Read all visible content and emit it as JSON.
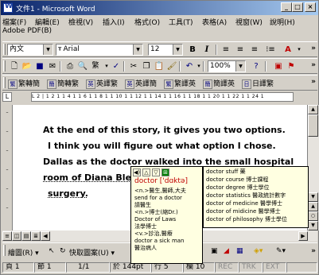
{
  "window": {
    "title": "文件1 - Microsoft Word"
  },
  "menu": [
    "檔案(F)",
    "編輯(E)",
    "檢視(V)",
    "插入(I)",
    "格式(O)",
    "工具(T)",
    "表格(A)",
    "視窗(W)",
    "說明(H)",
    "Adobe PDF(B)"
  ],
  "format_toolbar": {
    "style": "內文",
    "font": "Arial",
    "size": "12",
    "bold": "B",
    "italic": "I"
  },
  "standard_toolbar": {
    "zoom": "100%"
  },
  "convert_toolbar": [
    {
      "icon": "繁",
      "label": "繁轉簡"
    },
    {
      "icon": "簡",
      "label": "簡轉繁"
    },
    {
      "icon": "英",
      "label": "英譯繁"
    },
    {
      "icon": "英",
      "label": "英譯簡"
    },
    {
      "icon": "繁",
      "label": "繁譯英"
    },
    {
      "icon": "簡",
      "label": "簡譯英"
    },
    {
      "icon": "日",
      "label": "日譯繁"
    }
  ],
  "ruler": {
    "marks": "L   2 | 1 2 1  1 4 1  1 6 1  1 8 1  1 10 1  1 12 1  1 14 1  1 16 1  1 18 1  1 20 1  1 22 1  1 24 1"
  },
  "document": {
    "lines": [
      "At the end of this story, it gives you two options.",
      "I think you will figure out what option I chose.",
      "Dallas as the doctor walked into the small hospital",
      "room of Diana Ble",
      "surgery."
    ]
  },
  "dictionary_popup": {
    "icons": [
      "◀)",
      "△",
      "▽",
      "⊞"
    ],
    "headword": "doctor ['dɑktə]",
    "entries": [
      "<n.>醫生,醫師,大夫",
      "send for a doctor",
      "請醫生",
      "<n.>博士(縮Dr.)",
      "Doctor of Laws",
      "法學博士",
      "<v.>診治,醫療",
      "doctor a sick man",
      "醫治病人"
    ]
  },
  "related_popup": {
    "entries": [
      "doctor stuff 藥",
      "doctor course 博士課程",
      "doctor degree 博士學位",
      "doctor statistics 醫政統計數字",
      "doctor of medicine 醫學博士",
      "doctor of midicine 醫學博士",
      "doctor of philosophy 博士學位"
    ]
  },
  "drawing_toolbar": {
    "draw_label": "繪圖(R) ▾",
    "autoshape_label": "快取圖案(U) ▾"
  },
  "status_bar": {
    "page": "頁 1",
    "section": "節 1",
    "pages": "1/1",
    "position": "於 144pt",
    "line": "行 5",
    "column": "欄 10",
    "rec": "REC",
    "trk": "TRK",
    "ext": "EXT"
  }
}
